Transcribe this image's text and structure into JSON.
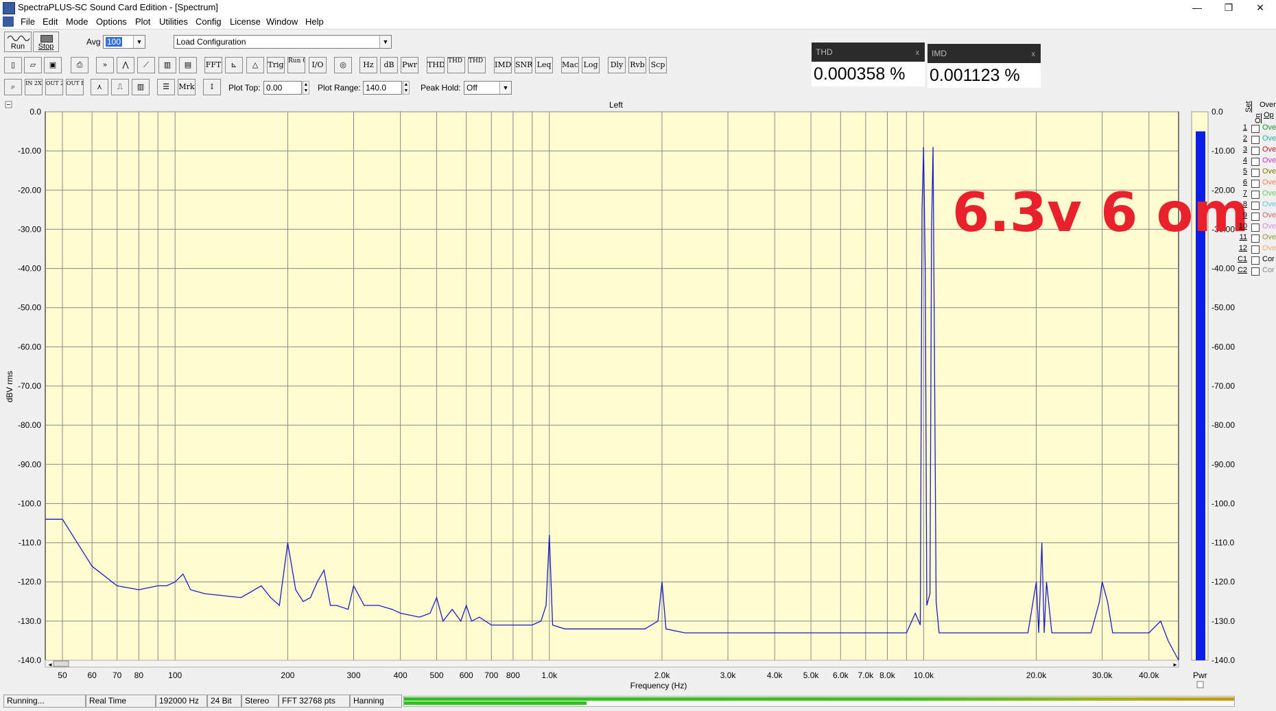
{
  "window": {
    "title": "SpectraPLUS-SC Sound Card Edition - [Spectrum]",
    "minimize": "—",
    "restore": "❐",
    "close": "✕"
  },
  "menu": [
    "File",
    "Edit",
    "Mode",
    "Options",
    "Plot",
    "Utilities",
    "Config",
    "License",
    "Window",
    "Help"
  ],
  "toolbar": {
    "run": "Run",
    "stop": "Stop",
    "avg_label": "Avg",
    "avg_value": "100",
    "load_config": "Load Configuration",
    "row2": [
      "FFT",
      "Trig",
      "Run Ctrl",
      "I/O",
      "Hz",
      "dB",
      "Pwr",
      "THD",
      "THD +N",
      "THD Freq",
      "IMD",
      "SNR",
      "Leq",
      "Mac",
      "Log",
      "Dly",
      "Rvb",
      "Scp"
    ],
    "row3": [
      "IN 2X",
      "OUT 2X",
      "OUT FULL",
      "Mrk"
    ],
    "plot_top_label": "Plot Top:",
    "plot_top_value": "0.00",
    "plot_range_label": "Plot Range:",
    "plot_range_value": "140.0",
    "peak_hold_label": "Peak Hold:",
    "peak_hold_value": "Off"
  },
  "meters": {
    "thd": {
      "name": "THD",
      "value": "0.000358 %",
      "close": "x"
    },
    "imd": {
      "name": "IMD",
      "value": "0.001123 %",
      "close": "x"
    }
  },
  "annotation": "6.3v 6 om",
  "chart_data": {
    "type": "line",
    "title": "Left",
    "xlabel": "Frequency (Hz)",
    "ylabel": "dBV rms",
    "xscale": "log",
    "xlim": [
      45,
      48000
    ],
    "ylim": [
      -140,
      0
    ],
    "yticks": [
      0,
      -10,
      -20,
      -30,
      -40,
      -50,
      -60,
      -70,
      -80,
      -90,
      -100,
      -110,
      -120,
      -130,
      -140
    ],
    "ytick_labels": [
      "0.0",
      "-10.00",
      "-20.00",
      "-30.00",
      "-40.00",
      "-50.00",
      "-60.00",
      "-70.00",
      "-80.00",
      "-90.00",
      "-100.0",
      "-110.0",
      "-120.0",
      "-130.0",
      "-140.0"
    ],
    "xticks": [
      50,
      60,
      70,
      80,
      100,
      200,
      300,
      400,
      500,
      600,
      700,
      800,
      1000,
      2000,
      3000,
      4000,
      5000,
      6000,
      7000,
      8000,
      10000,
      20000,
      30000,
      40000
    ],
    "xtick_labels": [
      "50",
      "60",
      "70",
      "80",
      "100",
      "200",
      "300",
      "400",
      "500",
      "600",
      "700",
      "800",
      "1.0k",
      "2.0k",
      "3.0k",
      "4.0k",
      "5.0k",
      "6.0k",
      "7.0k",
      "8.0k",
      "10.0k",
      "20.0k",
      "30.0k",
      "40.0k"
    ],
    "series": [
      {
        "color": "#1a1acc",
        "x": [
          45,
          50,
          60,
          70,
          80,
          90,
          95,
          100,
          105,
          110,
          120,
          150,
          170,
          180,
          190,
          200,
          210,
          220,
          230,
          240,
          250,
          260,
          270,
          290,
          300,
          320,
          350,
          380,
          400,
          450,
          480,
          500,
          520,
          550,
          580,
          600,
          620,
          650,
          700,
          750,
          800,
          850,
          900,
          950,
          980,
          1000,
          1020,
          1100,
          1300,
          1500,
          1800,
          1950,
          2000,
          2050,
          2300,
          3000,
          4000,
          5000,
          6000,
          7000,
          8000,
          9000,
          9500,
          9800,
          9900,
          10000,
          10100,
          10200,
          10400,
          10500,
          10600,
          10800,
          11000,
          11300,
          12000,
          15000,
          19000,
          20000,
          20300,
          20700,
          21000,
          21300,
          22000,
          25000,
          28000,
          29500,
          30000,
          31000,
          32000,
          35000,
          40000,
          43000,
          45000,
          48000
        ],
        "y": [
          -104,
          -104,
          -116,
          -121,
          -122,
          -121,
          -121,
          -120,
          -118,
          -122,
          -123,
          -124,
          -121,
          -124,
          -126,
          -110,
          -122,
          -125,
          -124,
          -120,
          -117,
          -126,
          -126,
          -127,
          -121,
          -126,
          -126,
          -127,
          -128,
          -129,
          -128,
          -124,
          -130,
          -127,
          -130,
          -126,
          -130,
          -129,
          -131,
          -131,
          -131,
          -131,
          -131,
          -130,
          -126,
          -108,
          -131,
          -132,
          -132,
          -132,
          -132,
          -130,
          -120,
          -132,
          -133,
          -133,
          -133,
          -133,
          -133,
          -133,
          -133,
          -133,
          -128,
          -131,
          -25,
          -9,
          -40,
          -126,
          -123,
          -30,
          -9,
          -125,
          -133,
          -133,
          -133,
          -133,
          -133,
          -120,
          -133,
          -110,
          -133,
          -120,
          -133,
          -133,
          -133,
          -125,
          -120,
          -125,
          -133,
          -133,
          -133,
          -130,
          -135,
          -140
        ]
      }
    ],
    "pwr_meter": {
      "label": "Pwr",
      "level_db": -5
    }
  },
  "overlay_sets": {
    "header_set": "Set",
    "header_on": "On",
    "header_over": "Over",
    "header_op": "Op",
    "items": [
      {
        "num": "1",
        "label": "Ove",
        "color": "#228b22"
      },
      {
        "num": "2",
        "label": "Ove",
        "color": "#20b2aa"
      },
      {
        "num": "3",
        "label": "Ove",
        "color": "#b22222"
      },
      {
        "num": "4",
        "label": "Ove",
        "color": "#cc33cc"
      },
      {
        "num": "5",
        "label": "Ove",
        "color": "#8b7500"
      },
      {
        "num": "6",
        "label": "Ove",
        "color": "#ff7f50"
      },
      {
        "num": "7",
        "label": "Ove",
        "color": "#66cc66"
      },
      {
        "num": "8",
        "label": "Ove",
        "color": "#66cccc"
      },
      {
        "num": "9",
        "label": "Ove",
        "color": "#cc6666"
      },
      {
        "num": "10",
        "label": "Ove",
        "color": "#dd88dd"
      },
      {
        "num": "11",
        "label": "Ove",
        "color": "#999933"
      },
      {
        "num": "12",
        "label": "Ove",
        "color": "#ffaa66"
      },
      {
        "num": "C1",
        "label": "Cor",
        "color": "#000000"
      },
      {
        "num": "C2",
        "label": "Cor",
        "color": "#888888"
      }
    ]
  },
  "status": {
    "state": "Running...",
    "mode": "Real Time",
    "rate": "192000 Hz",
    "bits": "24 Bit",
    "channels": "Stereo",
    "fft": "FFT 32768 pts",
    "window": "Hanning"
  }
}
